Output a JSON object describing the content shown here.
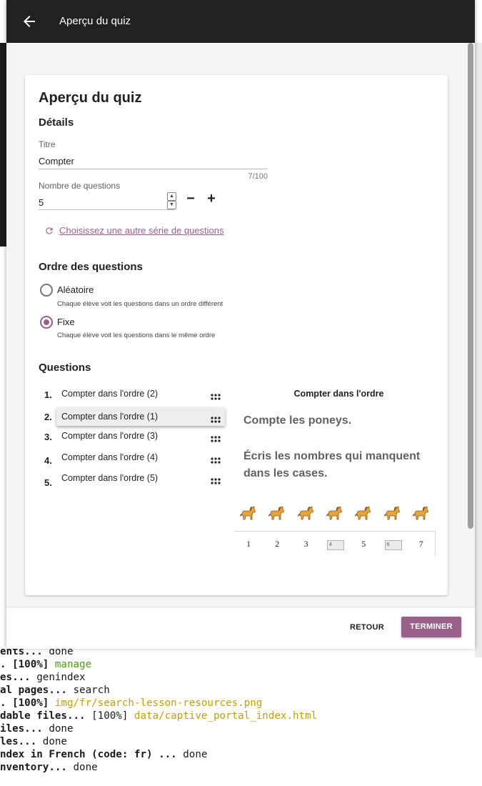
{
  "window": {
    "title": "Aperçu du quiz"
  },
  "card": {
    "title": "Aperçu du quiz",
    "details_heading": "Détails",
    "title_label": "Titre",
    "title_value": "Compter",
    "title_counter": "7/100",
    "count_label": "Nombre de questions",
    "count_value": "5",
    "minus_label": "−",
    "plus_label": "+",
    "choose_link": "Choisissez une autre série de questions",
    "order_heading": "Ordre des questions",
    "order_options": [
      {
        "label": "Aléatoire",
        "description": "Chaque élève voit les questions dans un ordre différent",
        "checked": false
      },
      {
        "label": "Fixe",
        "description": "Chaque élève voit les questions dans le même ordre",
        "checked": true
      }
    ],
    "questions_heading": "Questions",
    "questions": [
      {
        "num": "1.",
        "label": "Compter dans l'ordre (2)",
        "selected": false
      },
      {
        "num": "2.",
        "label": "Compter dans l'ordre (1)",
        "selected": true
      },
      {
        "num": "3.",
        "label": "Compter dans l'ordre (3)",
        "selected": false
      },
      {
        "num": "4.",
        "label": "Compter dans l'ordre (4)",
        "selected": false
      },
      {
        "num": "5.",
        "label": "Compter dans l'ordre (5)",
        "selected": false
      }
    ],
    "preview": {
      "title": "Compter dans l'ordre",
      "line1": "Compte les poneys.",
      "line2": "Écris les nombres qui manquent dans les cases.",
      "numbers": [
        "1",
        "2",
        "3",
        "",
        "5",
        "",
        "7"
      ],
      "boxes": [
        "4",
        "6"
      ],
      "pony_count": 7
    }
  },
  "footer": {
    "back_label": "RETOUR",
    "finish_label": "TERMINER"
  },
  "terminal": {
    "lines": [
      {
        "a": "ents... ",
        "b": "done",
        "c": ""
      },
      {
        "a": ". [100%] ",
        "b": "",
        "c": "manage"
      },
      {
        "a": "es... ",
        "b": "genindex",
        "c": ""
      },
      {
        "a": "al pages... ",
        "b": "search",
        "c": ""
      },
      {
        "a": ". [100%] ",
        "b": "",
        "c": "img/fr/search-lesson-resources.png"
      },
      {
        "a": "dable files... ",
        "b": "[100%] ",
        "c": "data/captive_portal_index.html"
      },
      {
        "a": "iles... ",
        "b": "done",
        "c": ""
      },
      {
        "a": "les... ",
        "b": "done",
        "c": ""
      },
      {
        "a": "ndex in French (code: fr) ... ",
        "b": "done",
        "c": ""
      },
      {
        "a": "nventory... ",
        "b": "done",
        "c": ""
      }
    ]
  },
  "colors": {
    "accent": "#996189",
    "appbar": "#212121"
  }
}
